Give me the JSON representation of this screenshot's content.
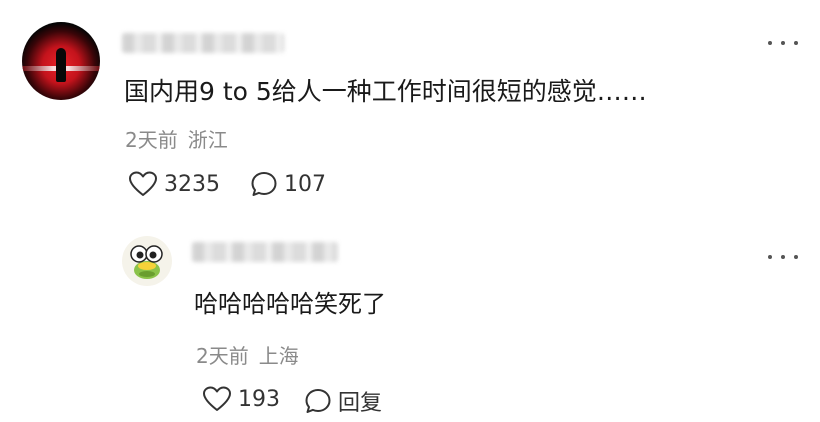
{
  "comment": {
    "text": "国内用9 to 5给人一种工作时间很短的感觉……",
    "time": "2天前",
    "location": "浙江",
    "likes": "3235",
    "replies": "107"
  },
  "reply": {
    "text": "哈哈哈哈哈笑死了",
    "time": "2天前",
    "location": "上海",
    "likes": "193",
    "reply_label": "回复"
  }
}
